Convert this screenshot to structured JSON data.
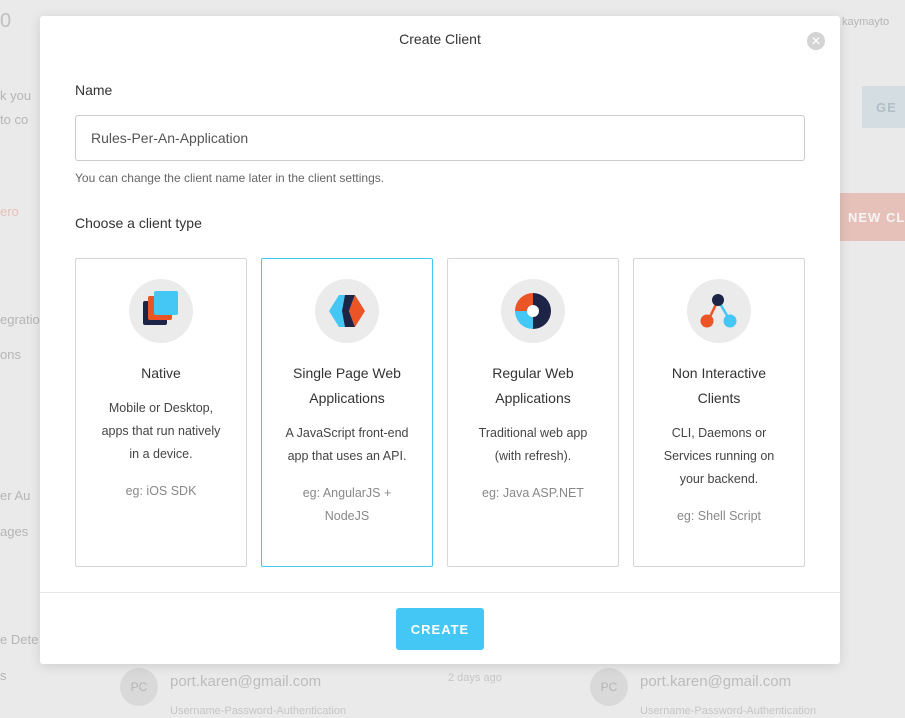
{
  "background": {
    "fragments": [
      "0",
      "k you",
      "to co",
      "ero",
      "egration",
      "ons",
      "er Au",
      "ages",
      "e Dete",
      "s"
    ],
    "primary_button_fragment": "GE",
    "new_client_fragment": "NEW CL",
    "header_user_fragment": "kaymayto",
    "list": [
      {
        "avatar": "PC",
        "email": "port.karen@gmail.com",
        "detail": "Username-Password-Authentication"
      },
      {
        "avatar": "PC",
        "email": "port.karen@gmail.com",
        "detail": "Username-Password-Authentication"
      }
    ],
    "list_mid_fragment": "2 days ago"
  },
  "modal": {
    "title": "Create Client",
    "close_icon": "close-icon",
    "name_label": "Name",
    "name_value": "Rules-Per-An-Application",
    "name_help": "You can change the client name later in the client settings.",
    "type_label": "Choose a client type",
    "client_types": [
      {
        "title_line1": "Native",
        "title_line2": "",
        "desc": [
          "Mobile or Desktop,",
          "apps that run natively",
          "in a device."
        ],
        "eg": [
          "eg: iOS SDK"
        ],
        "icon": "native-app-icon",
        "selected": false
      },
      {
        "title_line1": "Single Page Web",
        "title_line2": "Applications",
        "desc": [
          "A JavaScript front-end",
          "app that uses an API."
        ],
        "eg": [
          "eg: AngularJS +",
          "NodeJS"
        ],
        "icon": "spa-icon",
        "selected": true
      },
      {
        "title_line1": "Regular Web",
        "title_line2": "Applications",
        "desc": [
          "Traditional web app",
          "(with refresh)."
        ],
        "eg": [
          "eg: Java ASP.NET"
        ],
        "icon": "regular-web-app-icon",
        "selected": false
      },
      {
        "title_line1": "Non Interactive",
        "title_line2": "Clients",
        "desc": [
          "CLI, Daemons or",
          "Services running on",
          "your backend."
        ],
        "eg": [
          "eg: Shell Script"
        ],
        "icon": "non-interactive-client-icon",
        "selected": false
      }
    ],
    "create_label": "CREATE"
  },
  "colors": {
    "accent": "#44c7f4",
    "icon_dark": "#1d2445",
    "icon_orange": "#eb5424",
    "icon_blue": "#44c7f4"
  }
}
